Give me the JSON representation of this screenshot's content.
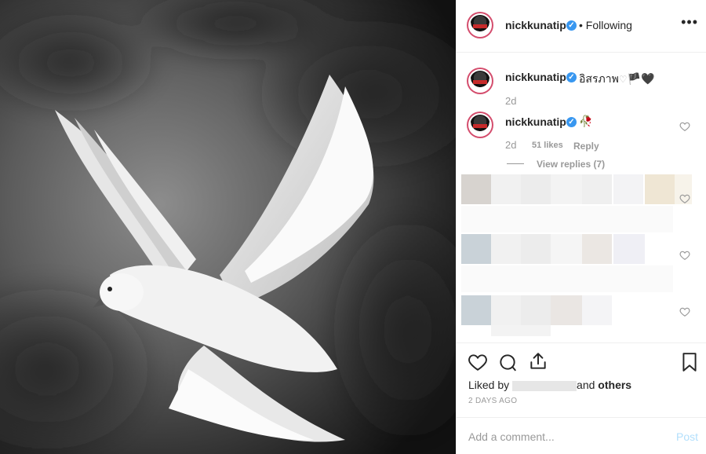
{
  "post": {
    "username": "nickkunatip",
    "follow_status": "Following",
    "more_label": "•••"
  },
  "caption": {
    "username": "nickkunatip",
    "text": "อิสรภาพ",
    "emoji_heart": "♡",
    "emoji_flag": "🏴",
    "emoji_black_heart": "🖤",
    "time": "2d"
  },
  "comment": {
    "username": "nickkunatip",
    "emoji": "🥀",
    "time": "2d",
    "likes": "51 likes",
    "reply": "Reply",
    "view_replies": "View replies (7)"
  },
  "likes": {
    "prefix": "Liked by",
    "connector": "and",
    "others": "others"
  },
  "date": "2 DAYS AGO",
  "add_comment": {
    "placeholder": "Add a comment...",
    "post_label": "Post"
  },
  "icons": {
    "like": "heart-icon",
    "comment": "comment-icon",
    "share": "share-icon",
    "save": "bookmark-icon",
    "comment_like": "heart-icon"
  }
}
